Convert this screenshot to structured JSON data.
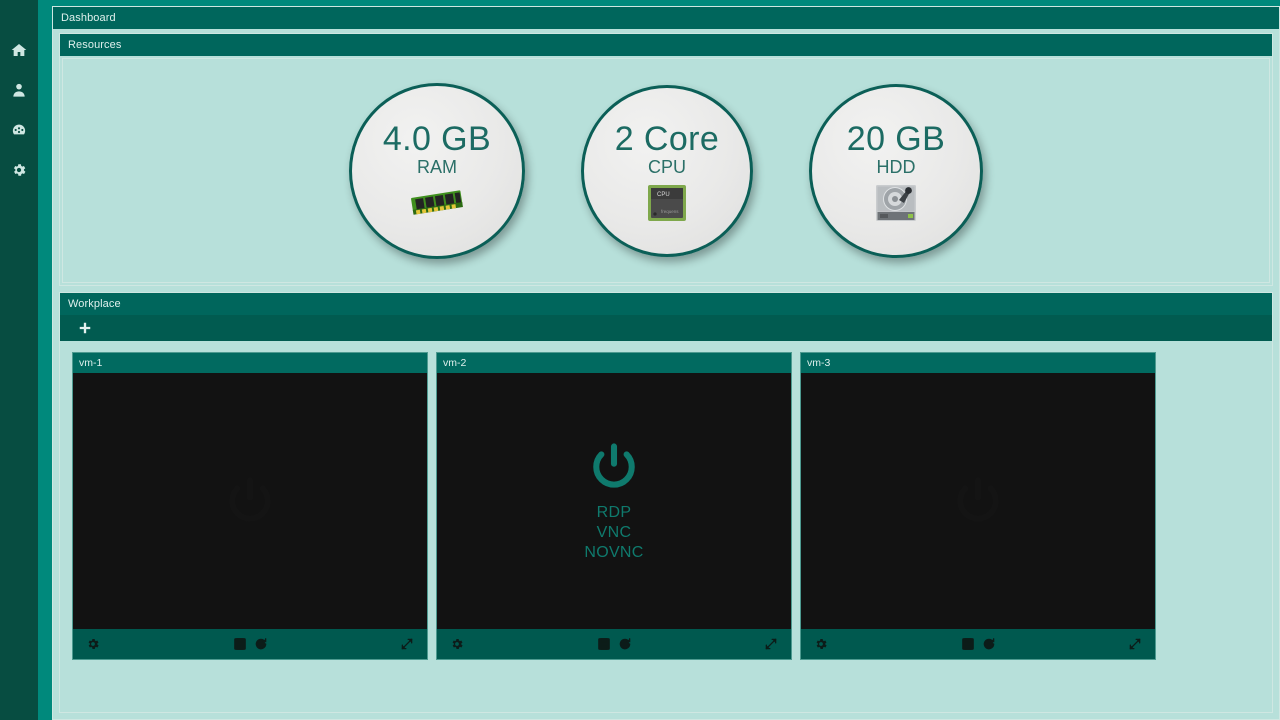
{
  "sidebar": {
    "items": [
      {
        "name": "home-icon",
        "label": "Home"
      },
      {
        "name": "user-icon",
        "label": "User"
      },
      {
        "name": "dashboard-icon",
        "label": "Dashboard"
      },
      {
        "name": "gear-icon",
        "label": "Settings"
      }
    ]
  },
  "dashboard": {
    "title": "Dashboard"
  },
  "resources": {
    "title": "Resources",
    "cards": [
      {
        "value": "4.0 GB",
        "label": "RAM",
        "icon": "ram-stick-icon"
      },
      {
        "value": "2 Core",
        "label": "CPU",
        "icon": "cpu-chip-icon"
      },
      {
        "value": "20 GB",
        "label": "HDD",
        "icon": "hard-disk-icon"
      }
    ]
  },
  "workplace": {
    "title": "Workplace",
    "add_label": "+",
    "vms": [
      {
        "title": "vm-1",
        "power_state": "off",
        "connections": [],
        "toolbar": {
          "settings": "settings",
          "save": "save",
          "restore": "restore",
          "expand": "expand"
        }
      },
      {
        "title": "vm-2",
        "power_state": "off",
        "connections": [
          "RDP",
          "VNC",
          "NOVNC"
        ],
        "toolbar": {
          "settings": "settings",
          "save": "save",
          "restore": "restore",
          "expand": "expand"
        }
      },
      {
        "title": "vm-3",
        "power_state": "off",
        "connections": [],
        "toolbar": {
          "settings": "settings",
          "save": "save",
          "restore": "restore",
          "expand": "expand"
        }
      }
    ]
  },
  "colors": {
    "sidebar": "#074d41",
    "header_teal": "#00665c",
    "panel_mint": "#b7e0da",
    "page_teal": "#00897c",
    "accent_teal": "#0f7a6d",
    "screen_black": "#121212"
  }
}
